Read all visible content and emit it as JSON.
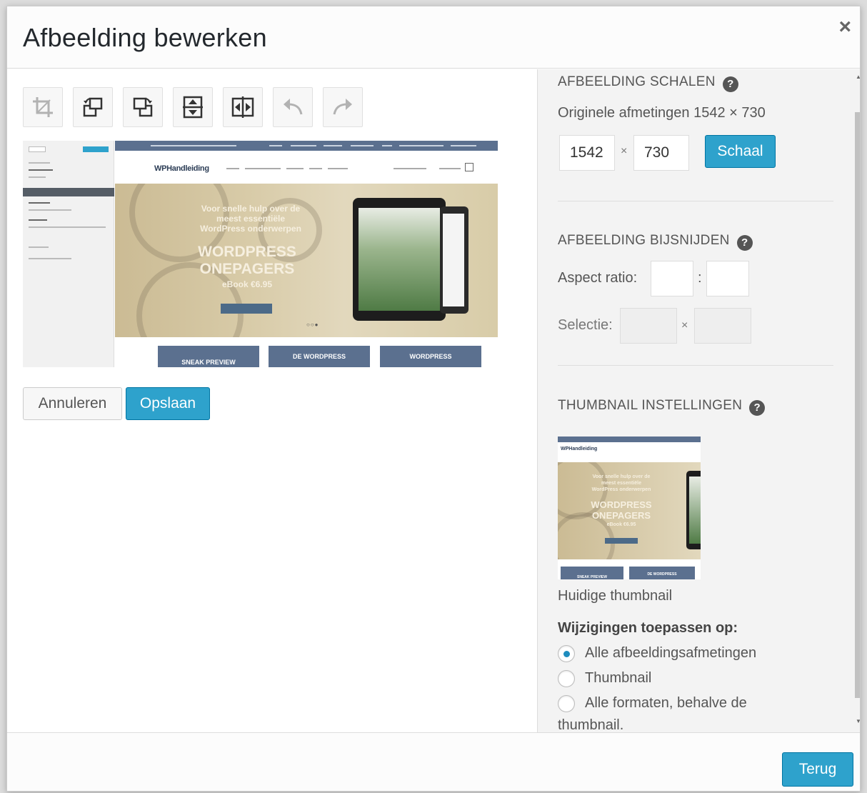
{
  "dialog": {
    "title": "Afbeelding bewerken",
    "close_glyph": "×"
  },
  "toolbar": {
    "buttons": [
      {
        "name": "crop-icon",
        "disabled": true
      },
      {
        "name": "rotate-left-icon",
        "disabled": false
      },
      {
        "name": "rotate-right-icon",
        "disabled": false
      },
      {
        "name": "flip-vertical-icon",
        "disabled": false
      },
      {
        "name": "flip-horizontal-icon",
        "disabled": false
      },
      {
        "name": "undo-icon",
        "disabled": true
      },
      {
        "name": "redo-icon",
        "disabled": true
      }
    ]
  },
  "preview": {
    "logo": "WPHandleiding",
    "hero_line1": "Voor snelle hulp over de",
    "hero_line2": "meest essentiële",
    "hero_line3": "WordPress onderwerpen",
    "hero_big1": "WORDPRESS",
    "hero_big2": "ONEPAGERS",
    "hero_price": "eBook €6.95",
    "tiles": [
      "SNEAK PREVIEW",
      "DE WORDPRESS",
      "WORDPRESS"
    ]
  },
  "actions": {
    "cancel_label": "Annuleren",
    "save_label": "Opslaan"
  },
  "scale": {
    "title": "Afbeelding schalen",
    "original_label": "Originele afmetingen 1542 × 730",
    "width_value": "1542",
    "height_value": "730",
    "times": "×",
    "button_label": "Schaal"
  },
  "crop": {
    "title": "Afbeelding bijsnijden",
    "aspect_label": "Aspect ratio:",
    "aspect_sep": ":",
    "selection_label": "Selectie:",
    "times": "×"
  },
  "thumbnail": {
    "title": "Thumbnail instellingen",
    "caption": "Huidige thumbnail",
    "thumb_logo": "WPHandleiding",
    "thumb_line1": "Voor snelle hulp over de",
    "thumb_line2": "meest essentiële",
    "thumb_line3": "WordPress onderwerpen",
    "thumb_big1": "WORDPRESS",
    "thumb_big2": "ONEPAGERS",
    "thumb_price": "eBook €6.95",
    "thumb_tiles": [
      "SNEAK PREVIEW",
      "DE WORDPRESS"
    ],
    "apply_label": "Wijzigingen toepassen op:",
    "options": [
      {
        "label": "Alle afbeeldingsafmetingen",
        "selected": true
      },
      {
        "label": "Thumbnail",
        "selected": false
      },
      {
        "label": "Alle formaten, behalve de",
        "selected": false
      }
    ],
    "option3_cont": "thumbnail."
  },
  "footer": {
    "back_label": "Terug"
  },
  "colors": {
    "primary": "#2ea2cc",
    "primary_border": "#0074a2",
    "help_icon": "#555555"
  }
}
